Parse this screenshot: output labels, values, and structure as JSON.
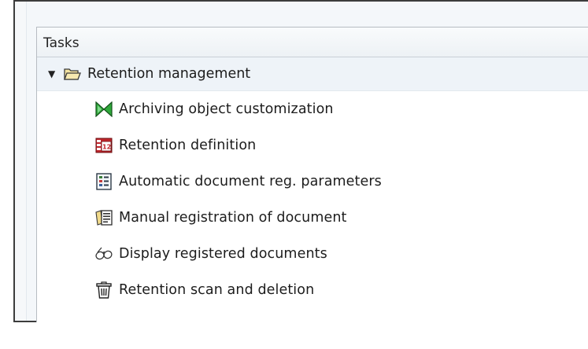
{
  "panel": {
    "title": "Tasks"
  },
  "tree": {
    "root": {
      "label": "Retention management",
      "expanded": true,
      "icon": "folder-open-icon"
    },
    "items": [
      {
        "label": "Archiving object customization",
        "icon": "bowtie-icon"
      },
      {
        "label": "Retention definition",
        "icon": "calendar-icon"
      },
      {
        "label": "Automatic document reg. parameters",
        "icon": "checklist-icon"
      },
      {
        "label": "Manual registration of document",
        "icon": "document-register-icon"
      },
      {
        "label": "Display registered documents",
        "icon": "glasses-icon"
      },
      {
        "label": "Retention scan and deletion",
        "icon": "trash-icon"
      }
    ]
  },
  "colors": {
    "panel_header_bg": "#edf1f5",
    "root_row_bg": "#eef3f8",
    "bowtie_green": "#2fa83a",
    "calendar_red": "#c0262c"
  }
}
